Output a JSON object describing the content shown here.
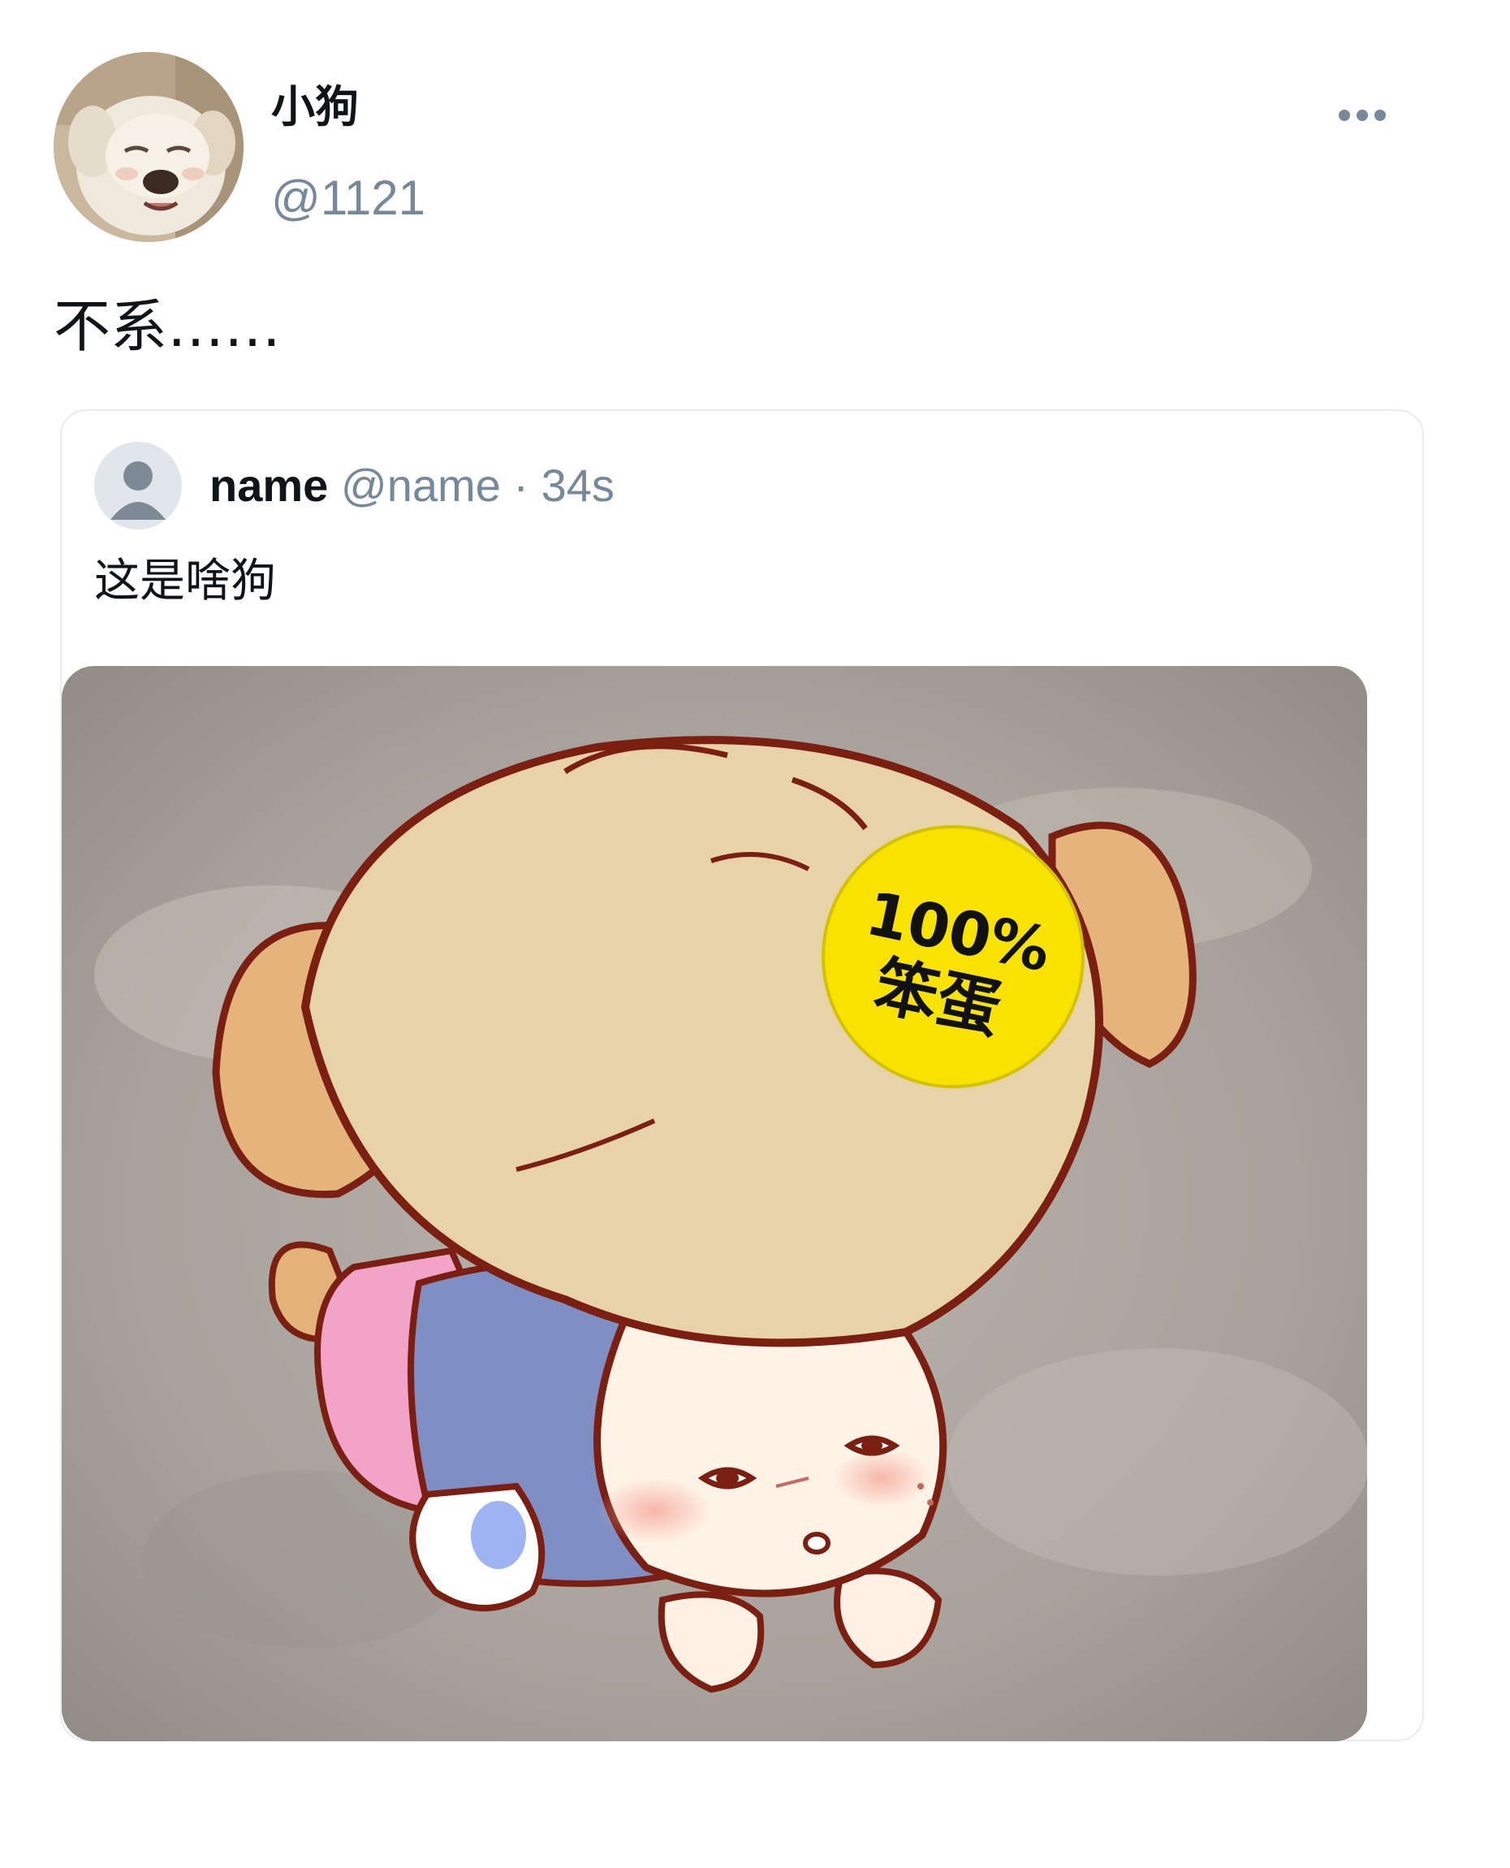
{
  "post": {
    "author": {
      "display_name": "小狗",
      "handle": "@1121",
      "avatar_icon": "puppy-avatar"
    },
    "more_icon": "more-horizontal-icon",
    "text": "不系……"
  },
  "quoted_post": {
    "author": {
      "display_name": "name",
      "handle": "@name",
      "avatar_icon": "default-user-avatar"
    },
    "separator": "·",
    "time": "34s",
    "text": "这是啥狗",
    "media": {
      "badge_line1": "100%",
      "badge_line2": "笨蛋"
    }
  },
  "colors": {
    "text_primary": "#0f1419",
    "text_secondary": "#76889a",
    "card_border": "#e6ecf0",
    "badge_yellow": "#f7e200"
  }
}
